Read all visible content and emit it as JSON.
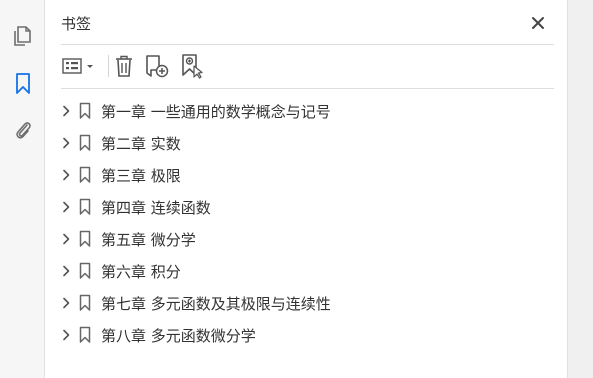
{
  "panel": {
    "title": "书签"
  },
  "bookmarks": [
    {
      "label": "第一章  一些通用的数学概念与记号"
    },
    {
      "label": "第二章  实数"
    },
    {
      "label": "第三章  极限"
    },
    {
      "label": "第四章  连续函数"
    },
    {
      "label": "第五章  微分学"
    },
    {
      "label": "第六章  积分"
    },
    {
      "label": "第七章  多元函数及其极限与连续性"
    },
    {
      "label": "第八章  多元函数微分学"
    }
  ],
  "colors": {
    "accent": "#1473e6",
    "icon": "#6e6e6e",
    "text": "#333333"
  }
}
